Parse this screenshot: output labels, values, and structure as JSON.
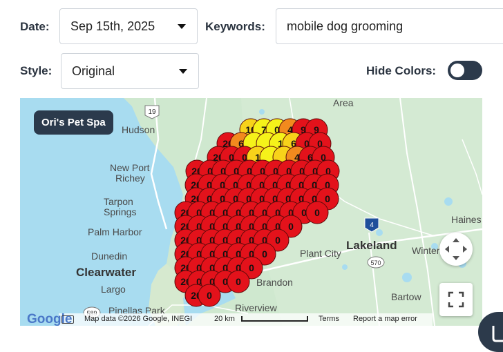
{
  "filters": {
    "date_label": "Date:",
    "date_value": "Sep 15th, 2025",
    "keywords_label": "Keywords:",
    "keywords_value": "mobile dog grooming",
    "style_label": "Style:",
    "style_value": "Original",
    "hide_colors_label": "Hide Colors:",
    "hide_colors_on": false
  },
  "map": {
    "business_badge": "Ori's Pet Spa",
    "places": [
      "Hudson",
      "New Port",
      "Richey",
      "Tarpon",
      "Springs",
      "Palm Harbor",
      "Dunedin",
      "Clearwater",
      "Largo",
      "Pinellas Park",
      "Brandon",
      "Riverview",
      "Plant City",
      "Lakeland",
      "Winter",
      "Bartow",
      "Haines",
      "Area"
    ],
    "road_shields": [
      "19",
      "589",
      "4",
      "570"
    ],
    "attribution": {
      "google": "Google",
      "map_data": "Map data ©2026 Google, INEGI",
      "scale": "20 km",
      "terms": "Terms",
      "report": "Report a map error"
    },
    "grid_colors": {
      "red": "#e3121b",
      "orange": "#f28a1e",
      "yellow": "#f5f21a",
      "gold": "#f7d21a"
    }
  }
}
